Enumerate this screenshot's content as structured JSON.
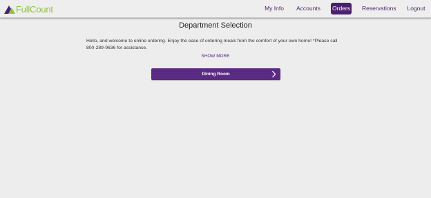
{
  "header": {
    "logo_text": "FullCount",
    "nav": [
      {
        "label": "My Info",
        "active": false
      },
      {
        "label": "Accounts",
        "active": false
      },
      {
        "label": "Orders",
        "active": true
      },
      {
        "label": "Reservations",
        "active": false
      },
      {
        "label": "Logout",
        "active": false
      }
    ]
  },
  "main": {
    "title": "Department Selection",
    "intro_text": "Hello, and welcome to online ordering. Enjoy the ease of ordering meals from the comfort of your own home! *Please call 800-289-9636 for assistance.",
    "show_more_label": "SHOW MORE",
    "departments": [
      {
        "label": "Dining Room",
        "icon": "chevron-right-icon"
      }
    ]
  },
  "colors": {
    "brand_purple": "#4b1f6f",
    "button_purple": "#5b2b83",
    "logo_green": "#8cc63f",
    "background": "#eeeded"
  }
}
